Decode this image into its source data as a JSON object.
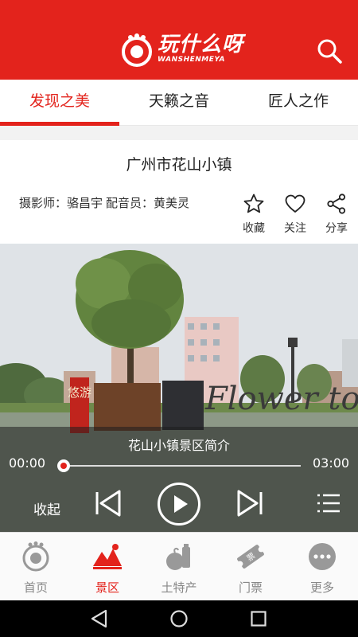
{
  "app": {
    "logo_cn": "玩什么呀",
    "logo_en": "WANSHENMEYA",
    "brand_color": "#e3231c"
  },
  "tabs": [
    {
      "label": "发现之美",
      "active": true
    },
    {
      "label": "天籁之音",
      "active": false
    },
    {
      "label": "匠人之作",
      "active": false
    }
  ],
  "article": {
    "title": "广州市花山小镇",
    "photographer_label": "摄影师：骆昌宇",
    "voice_label": "配音员：黄美灵",
    "actions": {
      "favorite": "收藏",
      "follow": "关注",
      "share": "分享"
    }
  },
  "photo": {
    "sign_left": "悠游",
    "sign_right": "Flower town"
  },
  "player": {
    "clip_title": "花山小镇景区简介",
    "current_time": "00:00",
    "total_time": "03:00",
    "progress": 0,
    "collapse_label": "收起"
  },
  "bottom_nav": [
    {
      "label": "首页",
      "icon": "home-icon",
      "active": false
    },
    {
      "label": "景区",
      "icon": "scenic-icon",
      "active": true
    },
    {
      "label": "土特产",
      "icon": "specialty-icon",
      "active": false
    },
    {
      "label": "门票",
      "icon": "ticket-icon",
      "active": false
    },
    {
      "label": "更多",
      "icon": "more-icon",
      "active": false
    }
  ]
}
